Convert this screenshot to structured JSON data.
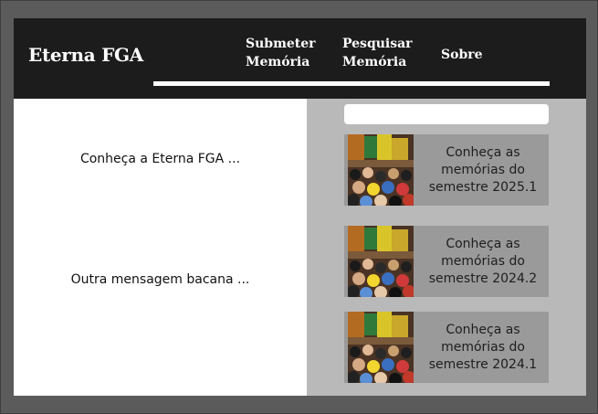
{
  "brand": {
    "title": "Eterna FGA"
  },
  "nav": {
    "submit": {
      "line1": "Submeter",
      "line2": "Memória"
    },
    "search": {
      "line1": "Pesquisar",
      "line2": "Memória"
    },
    "about": "Sobre"
  },
  "left": {
    "messages": [
      "Conheça a Eterna FGA ...",
      "Outra mensagem bacana ..."
    ]
  },
  "right": {
    "search_placeholder": "",
    "cards": [
      {
        "text": "Conheça as memórias do semestre 2025.1",
        "image": "group-photo"
      },
      {
        "text": "Conheça as memórias do semestre 2024.2",
        "image": "group-photo"
      },
      {
        "text": "Conheça as memórias do semestre 2024.1",
        "image": "group-photo"
      }
    ]
  }
}
